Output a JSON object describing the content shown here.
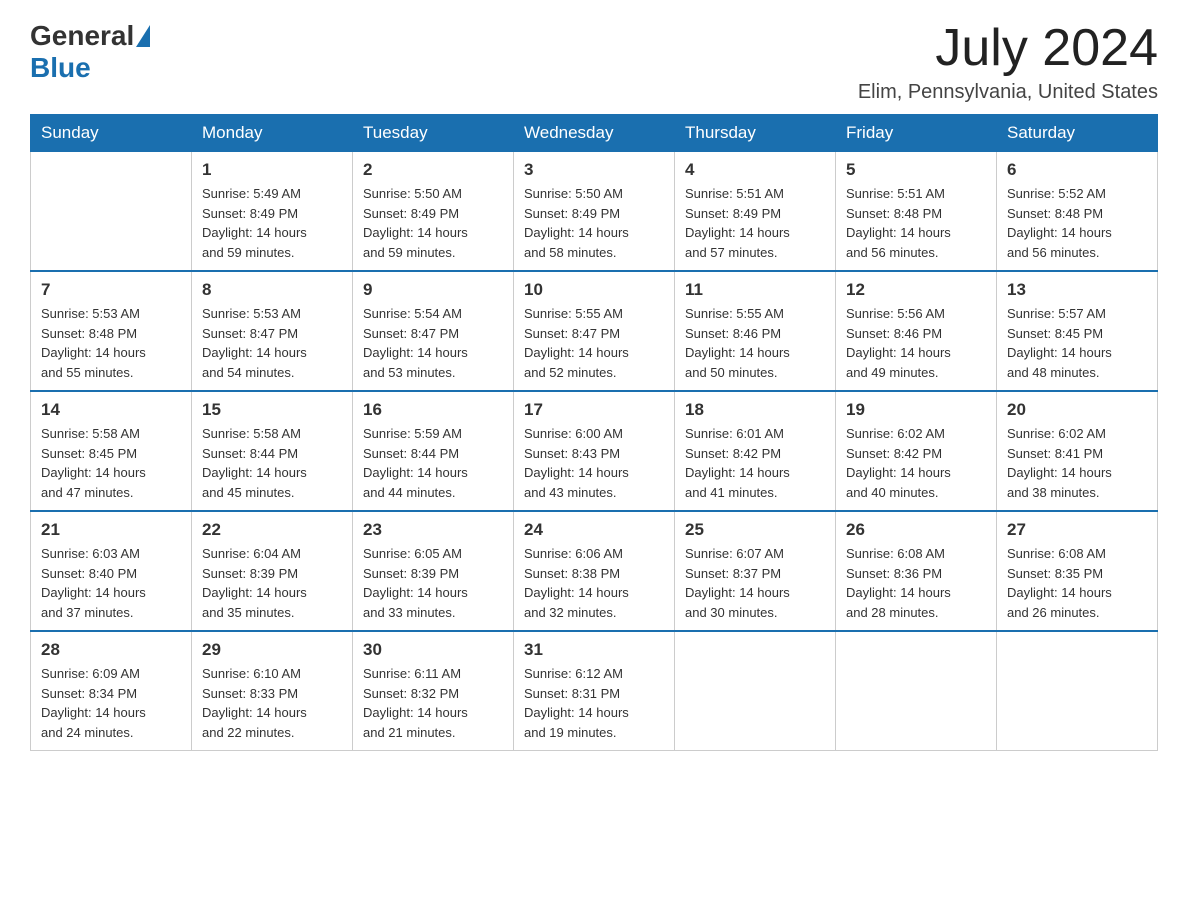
{
  "logo": {
    "general": "General",
    "blue": "Blue"
  },
  "header": {
    "month_year": "July 2024",
    "location": "Elim, Pennsylvania, United States"
  },
  "days_of_week": [
    "Sunday",
    "Monday",
    "Tuesday",
    "Wednesday",
    "Thursday",
    "Friday",
    "Saturday"
  ],
  "weeks": [
    [
      {
        "day": "",
        "sunrise": "",
        "sunset": "",
        "daylight": ""
      },
      {
        "day": "1",
        "sunrise": "5:49 AM",
        "sunset": "8:49 PM",
        "daylight": "14 hours and 59 minutes."
      },
      {
        "day": "2",
        "sunrise": "5:50 AM",
        "sunset": "8:49 PM",
        "daylight": "14 hours and 59 minutes."
      },
      {
        "day": "3",
        "sunrise": "5:50 AM",
        "sunset": "8:49 PM",
        "daylight": "14 hours and 58 minutes."
      },
      {
        "day": "4",
        "sunrise": "5:51 AM",
        "sunset": "8:49 PM",
        "daylight": "14 hours and 57 minutes."
      },
      {
        "day": "5",
        "sunrise": "5:51 AM",
        "sunset": "8:48 PM",
        "daylight": "14 hours and 56 minutes."
      },
      {
        "day": "6",
        "sunrise": "5:52 AM",
        "sunset": "8:48 PM",
        "daylight": "14 hours and 56 minutes."
      }
    ],
    [
      {
        "day": "7",
        "sunrise": "5:53 AM",
        "sunset": "8:48 PM",
        "daylight": "14 hours and 55 minutes."
      },
      {
        "day": "8",
        "sunrise": "5:53 AM",
        "sunset": "8:47 PM",
        "daylight": "14 hours and 54 minutes."
      },
      {
        "day": "9",
        "sunrise": "5:54 AM",
        "sunset": "8:47 PM",
        "daylight": "14 hours and 53 minutes."
      },
      {
        "day": "10",
        "sunrise": "5:55 AM",
        "sunset": "8:47 PM",
        "daylight": "14 hours and 52 minutes."
      },
      {
        "day": "11",
        "sunrise": "5:55 AM",
        "sunset": "8:46 PM",
        "daylight": "14 hours and 50 minutes."
      },
      {
        "day": "12",
        "sunrise": "5:56 AM",
        "sunset": "8:46 PM",
        "daylight": "14 hours and 49 minutes."
      },
      {
        "day": "13",
        "sunrise": "5:57 AM",
        "sunset": "8:45 PM",
        "daylight": "14 hours and 48 minutes."
      }
    ],
    [
      {
        "day": "14",
        "sunrise": "5:58 AM",
        "sunset": "8:45 PM",
        "daylight": "14 hours and 47 minutes."
      },
      {
        "day": "15",
        "sunrise": "5:58 AM",
        "sunset": "8:44 PM",
        "daylight": "14 hours and 45 minutes."
      },
      {
        "day": "16",
        "sunrise": "5:59 AM",
        "sunset": "8:44 PM",
        "daylight": "14 hours and 44 minutes."
      },
      {
        "day": "17",
        "sunrise": "6:00 AM",
        "sunset": "8:43 PM",
        "daylight": "14 hours and 43 minutes."
      },
      {
        "day": "18",
        "sunrise": "6:01 AM",
        "sunset": "8:42 PM",
        "daylight": "14 hours and 41 minutes."
      },
      {
        "day": "19",
        "sunrise": "6:02 AM",
        "sunset": "8:42 PM",
        "daylight": "14 hours and 40 minutes."
      },
      {
        "day": "20",
        "sunrise": "6:02 AM",
        "sunset": "8:41 PM",
        "daylight": "14 hours and 38 minutes."
      }
    ],
    [
      {
        "day": "21",
        "sunrise": "6:03 AM",
        "sunset": "8:40 PM",
        "daylight": "14 hours and 37 minutes."
      },
      {
        "day": "22",
        "sunrise": "6:04 AM",
        "sunset": "8:39 PM",
        "daylight": "14 hours and 35 minutes."
      },
      {
        "day": "23",
        "sunrise": "6:05 AM",
        "sunset": "8:39 PM",
        "daylight": "14 hours and 33 minutes."
      },
      {
        "day": "24",
        "sunrise": "6:06 AM",
        "sunset": "8:38 PM",
        "daylight": "14 hours and 32 minutes."
      },
      {
        "day": "25",
        "sunrise": "6:07 AM",
        "sunset": "8:37 PM",
        "daylight": "14 hours and 30 minutes."
      },
      {
        "day": "26",
        "sunrise": "6:08 AM",
        "sunset": "8:36 PM",
        "daylight": "14 hours and 28 minutes."
      },
      {
        "day": "27",
        "sunrise": "6:08 AM",
        "sunset": "8:35 PM",
        "daylight": "14 hours and 26 minutes."
      }
    ],
    [
      {
        "day": "28",
        "sunrise": "6:09 AM",
        "sunset": "8:34 PM",
        "daylight": "14 hours and 24 minutes."
      },
      {
        "day": "29",
        "sunrise": "6:10 AM",
        "sunset": "8:33 PM",
        "daylight": "14 hours and 22 minutes."
      },
      {
        "day": "30",
        "sunrise": "6:11 AM",
        "sunset": "8:32 PM",
        "daylight": "14 hours and 21 minutes."
      },
      {
        "day": "31",
        "sunrise": "6:12 AM",
        "sunset": "8:31 PM",
        "daylight": "14 hours and 19 minutes."
      },
      {
        "day": "",
        "sunrise": "",
        "sunset": "",
        "daylight": ""
      },
      {
        "day": "",
        "sunrise": "",
        "sunset": "",
        "daylight": ""
      },
      {
        "day": "",
        "sunrise": "",
        "sunset": "",
        "daylight": ""
      }
    ]
  ],
  "labels": {
    "sunrise_prefix": "Sunrise: ",
    "sunset_prefix": "Sunset: ",
    "daylight_prefix": "Daylight: "
  }
}
